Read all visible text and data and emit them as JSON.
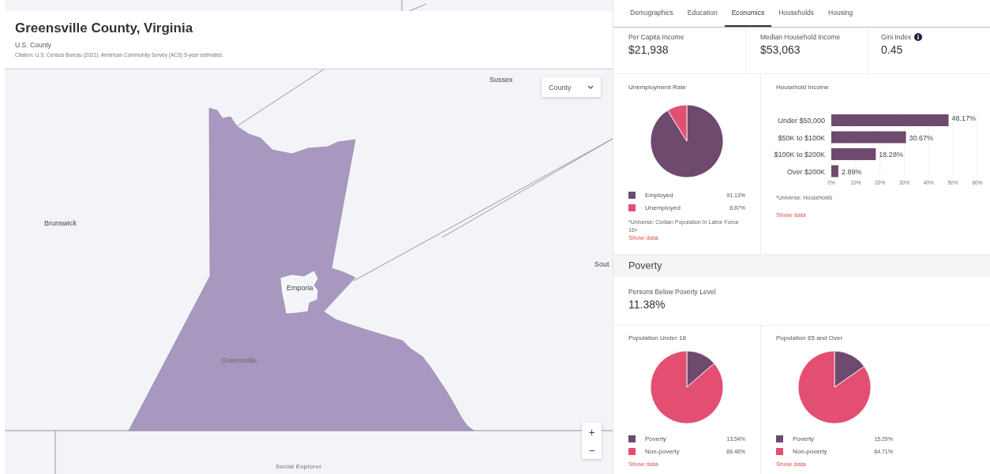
{
  "map": {
    "title": "Greensville County, Virginia",
    "subtitle": "U.S. County",
    "citation": "Citation: U.S. Census Bureau (2021). American Community Survey (ACS) 5-year estimates.",
    "geography_select": {
      "value": "County"
    },
    "labels": [
      {
        "text": "Sussex",
        "kind": "neighbor"
      },
      {
        "text": "Brunswick",
        "kind": "neighbor"
      },
      {
        "text": "Sout",
        "kind": "neighbor"
      },
      {
        "text": "Emporia",
        "kind": "city"
      },
      {
        "text": "Greensville",
        "kind": "selected"
      }
    ],
    "zoom_in": "+",
    "zoom_out": "−",
    "logo": "Social Explorer"
  },
  "tabs": [
    {
      "label": "Demographics",
      "selected": false
    },
    {
      "label": "Education",
      "selected": false
    },
    {
      "label": "Economics",
      "selected": true
    },
    {
      "label": "Households",
      "selected": false
    },
    {
      "label": "Housing",
      "selected": false
    }
  ],
  "stats": [
    {
      "label": "Per Capita Income",
      "value": "$21,938",
      "info": false
    },
    {
      "label": "Median Household Income",
      "value": "$53,063",
      "info": false
    },
    {
      "label": "Gini Index",
      "value": "0.45",
      "info": true
    }
  ],
  "unemployment": {
    "title": "Unemployment Rate",
    "chart_data": {
      "type": "pie",
      "categories": [
        "Employed",
        "Unemployed"
      ],
      "values": [
        91.13,
        8.87
      ]
    },
    "legend": [
      {
        "value": "91.13%",
        "color": "#6e4a6e"
      },
      {
        "value": "8.87%",
        "color": "#e34f73"
      }
    ],
    "note": "*Universe: Civilian Population In Labor Force 16+",
    "link": "Show data"
  },
  "household_income": {
    "title": "Household Income",
    "chart_data": {
      "type": "bar",
      "orientation": "horizontal",
      "categories": [
        "Under $50,000",
        "$50K to $100K",
        "$100K to $200K",
        "Over $200K"
      ],
      "series": [
        {
          "color": "#6e4a6e",
          "values": [
            48.17,
            30.67,
            18.28,
            2.89
          ]
        }
      ],
      "grid": true,
      "value_labels": [
        "48.17%",
        "30.67%",
        "18.28%",
        "2.89%"
      ],
      "xlim": [
        0,
        60
      ],
      "xticks": [
        {
          "value": 0,
          "label": "0%"
        },
        {
          "value": 10,
          "label": "10%"
        },
        {
          "value": 20,
          "label": "20%"
        },
        {
          "value": 30,
          "label": "30%"
        },
        {
          "value": 40,
          "label": "40%"
        },
        {
          "value": 50,
          "label": "50%"
        },
        {
          "value": 60,
          "label": "60%"
        }
      ]
    },
    "note": "*Universe: Households",
    "link": "Show data"
  },
  "poverty": {
    "heading": "Poverty",
    "stat": {
      "label": "Persons Below Poverty Level",
      "value": "11.38%"
    },
    "charts": [
      {
        "title": "Population Under 18",
        "chart_data": {
          "type": "pie",
          "categories": [
            "Poverty",
            "Non-poverty"
          ],
          "values": [
            13.54,
            86.46
          ]
        },
        "legend": [
          {
            "value": "13.54%",
            "color": "#6e4a6e"
          },
          {
            "value": "86.46%",
            "color": "#e34f73"
          }
        ],
        "link": "Show data"
      },
      {
        "title": "Population 65 and Over",
        "chart_data": {
          "type": "pie",
          "categories": [
            "Poverty",
            "Non-poverty"
          ],
          "values": [
            15.29,
            84.71
          ]
        },
        "legend": [
          {
            "value": "15.29%",
            "color": "#6e4a6e"
          },
          {
            "value": "84.71%",
            "color": "#e34f73"
          }
        ],
        "link": "Show data"
      }
    ]
  }
}
